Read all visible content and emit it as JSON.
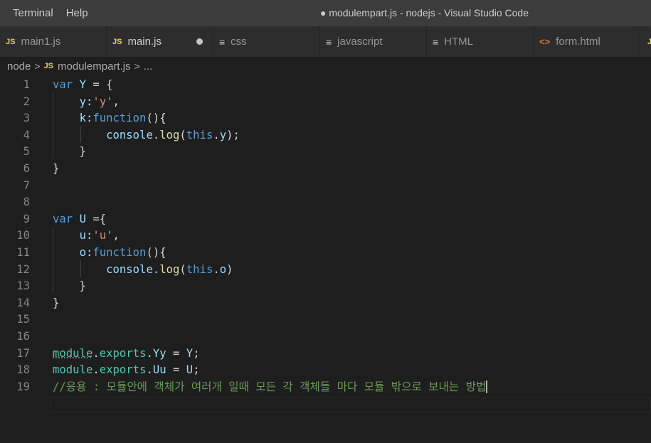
{
  "menu": {
    "terminal": "Terminal",
    "help": "Help"
  },
  "window_title": "● modulempart.js - nodejs - Visual Studio Code",
  "tabs": [
    {
      "icon": "JS",
      "label": "main1.js"
    },
    {
      "icon": "JS",
      "label": "main.js"
    },
    {
      "icon": "≡",
      "label": "css"
    },
    {
      "icon": "≡",
      "label": "javascript"
    },
    {
      "icon": "≡",
      "label": "HTML"
    },
    {
      "icon": "<>",
      "label": "form.html"
    },
    {
      "icon": "JS",
      "label": ""
    }
  ],
  "breadcrumb": {
    "folder": "node",
    "sep1": ">",
    "file_icon": "JS",
    "file": "modulempart.js",
    "sep2": ">",
    "more": "..."
  },
  "lines": [
    {
      "n": "1",
      "tokens": [
        [
          "var",
          "k"
        ],
        [
          " ",
          "p"
        ],
        [
          "Y",
          "v"
        ],
        [
          " = {",
          "p"
        ]
      ]
    },
    {
      "n": "2",
      "tokens": [
        [
          "    ",
          "p"
        ],
        [
          "y",
          "v"
        ],
        [
          ":",
          "p"
        ],
        [
          "'y'",
          "s"
        ],
        [
          ",",
          "p"
        ]
      ]
    },
    {
      "n": "3",
      "tokens": [
        [
          "    ",
          "p"
        ],
        [
          "k",
          "v"
        ],
        [
          ":",
          "p"
        ],
        [
          "function",
          "k"
        ],
        [
          "(){",
          "p"
        ]
      ]
    },
    {
      "n": "4",
      "tokens": [
        [
          "        ",
          "p"
        ],
        [
          "console",
          "v"
        ],
        [
          ".",
          "p"
        ],
        [
          "log",
          "f"
        ],
        [
          "(",
          "p"
        ],
        [
          "this",
          "k"
        ],
        [
          ".",
          "p"
        ],
        [
          "y",
          "v"
        ],
        [
          ");",
          "p"
        ]
      ]
    },
    {
      "n": "5",
      "tokens": [
        [
          "    }",
          "p"
        ]
      ]
    },
    {
      "n": "6",
      "tokens": [
        [
          "}",
          "p"
        ]
      ]
    },
    {
      "n": "7",
      "tokens": []
    },
    {
      "n": "8",
      "tokens": []
    },
    {
      "n": "9",
      "tokens": [
        [
          "var",
          "k"
        ],
        [
          " ",
          "p"
        ],
        [
          "U",
          "v"
        ],
        [
          " ={",
          "p"
        ]
      ]
    },
    {
      "n": "10",
      "tokens": [
        [
          "    ",
          "p"
        ],
        [
          "u",
          "v"
        ],
        [
          ":",
          "p"
        ],
        [
          "'u'",
          "s"
        ],
        [
          ",",
          "p"
        ]
      ]
    },
    {
      "n": "11",
      "tokens": [
        [
          "    ",
          "p"
        ],
        [
          "o",
          "v"
        ],
        [
          ":",
          "p"
        ],
        [
          "function",
          "k"
        ],
        [
          "(){",
          "p"
        ]
      ]
    },
    {
      "n": "12",
      "tokens": [
        [
          "        ",
          "p"
        ],
        [
          "console",
          "v"
        ],
        [
          ".",
          "p"
        ],
        [
          "log",
          "f"
        ],
        [
          "(",
          "p"
        ],
        [
          "this",
          "k"
        ],
        [
          ".",
          "p"
        ],
        [
          "o",
          "v"
        ],
        [
          ")",
          "p"
        ]
      ]
    },
    {
      "n": "13",
      "tokens": [
        [
          "    }",
          "p"
        ]
      ]
    },
    {
      "n": "14",
      "tokens": [
        [
          "}",
          "p"
        ]
      ]
    },
    {
      "n": "15",
      "tokens": []
    },
    {
      "n": "16",
      "tokens": []
    },
    {
      "n": "17",
      "tokens": [
        [
          "module",
          "t"
        ],
        [
          ".",
          "p"
        ],
        [
          "exports",
          "t"
        ],
        [
          ".",
          "p"
        ],
        [
          "Yy",
          "v"
        ],
        [
          " = ",
          "p"
        ],
        [
          "Y",
          "v"
        ],
        [
          ";",
          "p"
        ]
      ]
    },
    {
      "n": "18",
      "tokens": [
        [
          "module",
          "t"
        ],
        [
          ".",
          "p"
        ],
        [
          "exports",
          "t"
        ],
        [
          ".",
          "p"
        ],
        [
          "Uu",
          "v"
        ],
        [
          " = ",
          "p"
        ],
        [
          "U",
          "v"
        ],
        [
          ";",
          "p"
        ]
      ]
    },
    {
      "n": "19",
      "tokens": [
        [
          "//응용 : 모듈안에 객체가 여러개 일때 모든 각 객체들 마다 모듈 밖으로 보내는 방법",
          "c"
        ]
      ]
    }
  ],
  "colors": {
    "keyword": "#569cd6",
    "variable": "#9cdcfe",
    "string": "#ce9178",
    "function": "#dcdcaa",
    "type": "#4ec9b0",
    "comment": "#6a9955",
    "js_icon": "#e8d44d",
    "html_icon": "#e37933"
  }
}
